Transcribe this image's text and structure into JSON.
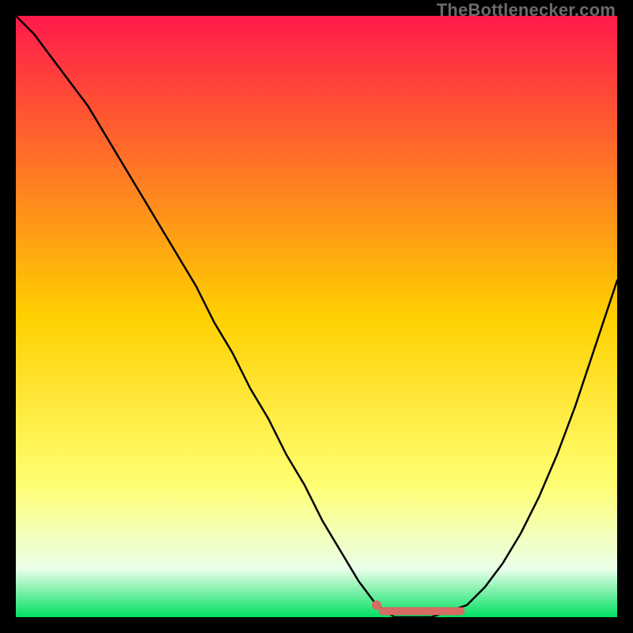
{
  "watermark": "TheBottlenecker.com",
  "colors": {
    "gradient_top": "#ff1a4b",
    "gradient_mid": "#ffd000",
    "gradient_low": "#ffff73",
    "gradient_pale": "#eaffea",
    "gradient_bottom": "#00e060",
    "curve": "#000000",
    "marker_stroke": "#d86b63",
    "marker_fill": "#d86b63"
  },
  "chart_data": {
    "type": "line",
    "title": "",
    "xlabel": "",
    "ylabel": "",
    "xlim": [
      0,
      100
    ],
    "ylim": [
      0,
      100
    ],
    "series": [
      {
        "name": "bottleneck-curve",
        "x": [
          0,
          3,
          6,
          9,
          12,
          15,
          18,
          21,
          24,
          27,
          30,
          33,
          36,
          39,
          42,
          45,
          48,
          51,
          54,
          57,
          60,
          63,
          66,
          69,
          72,
          75,
          78,
          81,
          84,
          87,
          90,
          93,
          96,
          100
        ],
        "y": [
          100,
          97,
          93,
          89,
          85,
          80,
          75,
          70,
          65,
          60,
          55,
          49,
          44,
          38,
          33,
          27,
          22,
          16,
          11,
          6,
          2,
          0,
          0,
          0,
          1,
          2,
          5,
          9,
          14,
          20,
          27,
          35,
          44,
          56
        ]
      }
    ],
    "marker": {
      "name": "optimal-range",
      "dot": {
        "x": 60,
        "y": 2
      },
      "segment": {
        "x0": 61,
        "y0": 1,
        "x1": 74,
        "y1": 1
      }
    }
  }
}
